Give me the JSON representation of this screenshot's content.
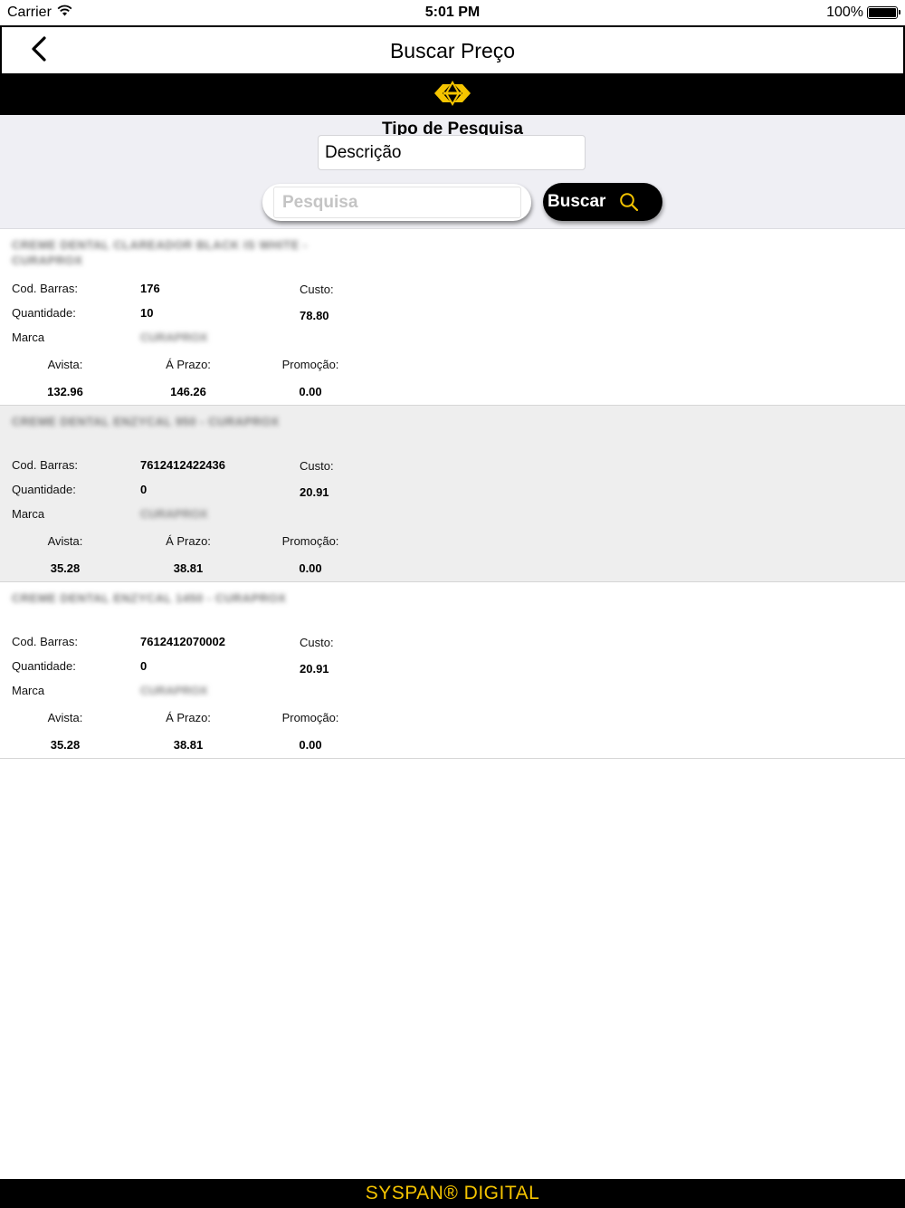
{
  "status_bar": {
    "carrier": "Carrier",
    "time": "5:01 PM",
    "battery": "100%",
    "battery_level": 1.0
  },
  "nav": {
    "title": "Buscar Preço"
  },
  "colors": {
    "accent": "#f5c400",
    "background": "#efeff4",
    "row_alt": "#eeeeee"
  },
  "search": {
    "type_label": "Tipo de Pesquisa",
    "type_value": "Descrição",
    "placeholder": "Pesquisa",
    "button_label": "Buscar"
  },
  "labels": {
    "cod_barras": "Cod. Barras:",
    "quantidade": "Quantidade:",
    "marca": "Marca",
    "custo": "Custo:",
    "avista": "Avista:",
    "aprazo": "Á Prazo:",
    "promocao": "Promoção:"
  },
  "products": [
    {
      "title": "CREME DENTAL CLAREADOR BLACK IS WHITE - CURAPROX",
      "cod_barras": "176",
      "quantidade": "10",
      "marca": "CURAPROX",
      "custo": "78.80",
      "avista": "132.96",
      "aprazo": "146.26",
      "promocao": "0.00"
    },
    {
      "title": "CREME DENTAL ENZYCAL 950 - CURAPROX",
      "cod_barras": "7612412422436",
      "quantidade": "0",
      "marca": "CURAPROX",
      "custo": "20.91",
      "avista": "35.28",
      "aprazo": "38.81",
      "promocao": "0.00"
    },
    {
      "title": "CREME DENTAL ENZYCAL 1450 - CURAPROX",
      "cod_barras": "7612412070002",
      "quantidade": "0",
      "marca": "CURAPROX",
      "custo": "20.91",
      "avista": "35.28",
      "aprazo": "38.81",
      "promocao": "0.00"
    }
  ],
  "footer": {
    "text": "SYSPAN® DIGITAL"
  }
}
